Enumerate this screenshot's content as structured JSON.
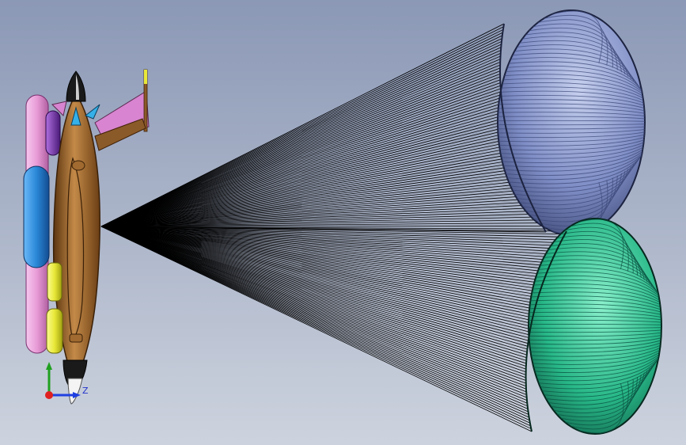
{
  "window": {
    "background_top": "#8b98b6",
    "background_bottom": "#cdd3de"
  },
  "scene": {
    "description_items": [
      "rocket-body",
      "upper-parachute",
      "lower-parachute",
      "suspension-lines"
    ],
    "colors": {
      "fuselage": "#8a5a28",
      "fuselage_highlight": "#c48a48",
      "pink_tank": "#e79ad6",
      "blue_tank": "#2a88d8",
      "purple_tank": "#7a3aa8",
      "yellow_tank": "#e8e838",
      "nose": "#1a1a1a",
      "fin": "#d884d0",
      "upper_canopy": "#7f8ec6",
      "upper_canopy_dark": "#3c4878",
      "lower_canopy": "#28b888",
      "lower_canopy_dark": "#0a5040",
      "lines": "#000000"
    }
  },
  "triad": {
    "z_label": "Z",
    "x_color": "#e02020",
    "y_color": "#20a020",
    "z_color": "#2040e0"
  }
}
